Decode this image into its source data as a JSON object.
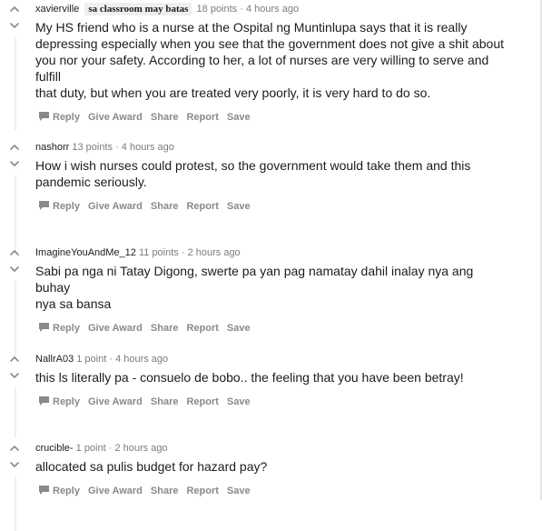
{
  "actions": {
    "reply": "Reply",
    "give_award": "Give Award",
    "share": "Share",
    "report": "Report",
    "save": "Save"
  },
  "icons": {
    "upvote": "chevron-up-icon",
    "downvote": "chevron-down-icon",
    "reply": "speech-bubble-icon"
  },
  "colors": {
    "meta_text": "#7c7c7c",
    "action_text": "#878a8c",
    "body_text": "#1c1c1c",
    "vote_arrow": "#878a8c",
    "thread_line": "#edeff1"
  },
  "comments": [
    {
      "author": "xavierville",
      "flair": "sa classroom may batas",
      "points": "18 points",
      "time": "4 hours ago",
      "lines": [
        "My HS friend who is a nurse at the Ospital ng Muntinlupa says that it is really",
        "depressing especially when you see that the government does not give a shit about",
        "you nor your safety. According to her, a lot of nurses are very willing to serve and fulfill",
        "that duty, but when you are treated very poorly, it is very hard to do so."
      ]
    },
    {
      "author": "nashorr",
      "flair": "",
      "points": "13 points",
      "time": "4 hours ago",
      "lines": [
        "How i wish nurses could protest, so the government would take them and this",
        "pandemic seriously."
      ]
    },
    {
      "author": "ImagineYouAndMe_12",
      "flair": "",
      "points": "11 points",
      "time": "2 hours ago",
      "lines": [
        "Sabi pa nga ni Tatay Digong, swerte pa yan pag namatay dahil inalay nya ang buhay",
        "nya sa bansa"
      ]
    },
    {
      "author": "NallrA03",
      "flair": "",
      "points": "1 point",
      "time": "4 hours ago",
      "lines": [
        "this ls literally pa - consuelo de bobo.. the feeling that you have been betray!"
      ]
    },
    {
      "author": "crucible-",
      "flair": "",
      "points": "1 point",
      "time": "2 hours ago",
      "lines": [
        "allocated sa pulis budget for hazard pay?"
      ]
    }
  ]
}
